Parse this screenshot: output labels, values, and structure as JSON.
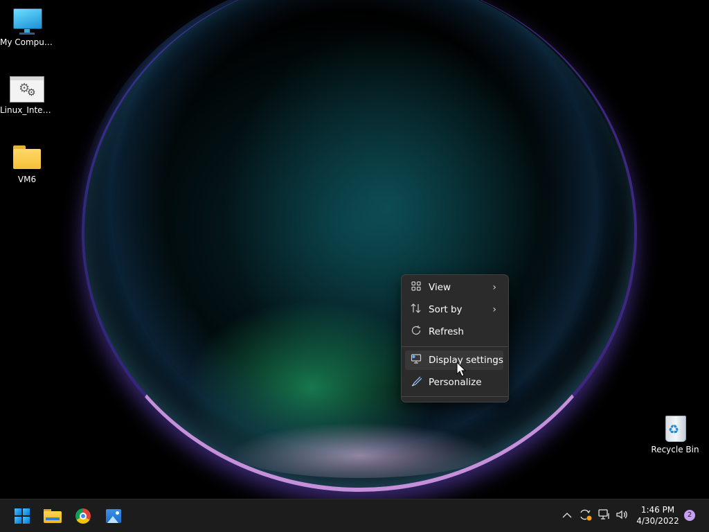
{
  "desktop": {
    "icons": [
      {
        "label": "My Computer"
      },
      {
        "label": "Linux_Interj..."
      },
      {
        "label": "VM6"
      },
      {
        "label": "Recycle Bin"
      }
    ]
  },
  "context_menu": {
    "items": [
      {
        "label": "View",
        "icon": "grid-view-icon",
        "has_submenu": true
      },
      {
        "label": "Sort by",
        "icon": "sort-arrows-icon",
        "has_submenu": true
      },
      {
        "label": "Refresh",
        "icon": "refresh-icon",
        "has_submenu": false
      },
      {
        "label": "Display settings",
        "icon": "display-settings-icon",
        "has_submenu": false,
        "hovered": true
      },
      {
        "label": "Personalize",
        "icon": "brush-icon",
        "has_submenu": false
      }
    ]
  },
  "taskbar": {
    "apps": [
      "start-button",
      "file-explorer",
      "chrome",
      "photos"
    ],
    "tray": {
      "time": "1:46 PM",
      "date": "4/30/2022",
      "notification_count": "2"
    }
  },
  "colors": {
    "menu_bg": "#2b2b2b",
    "taskbar_bg": "#1c1c1c",
    "accent": "#0078d4"
  }
}
